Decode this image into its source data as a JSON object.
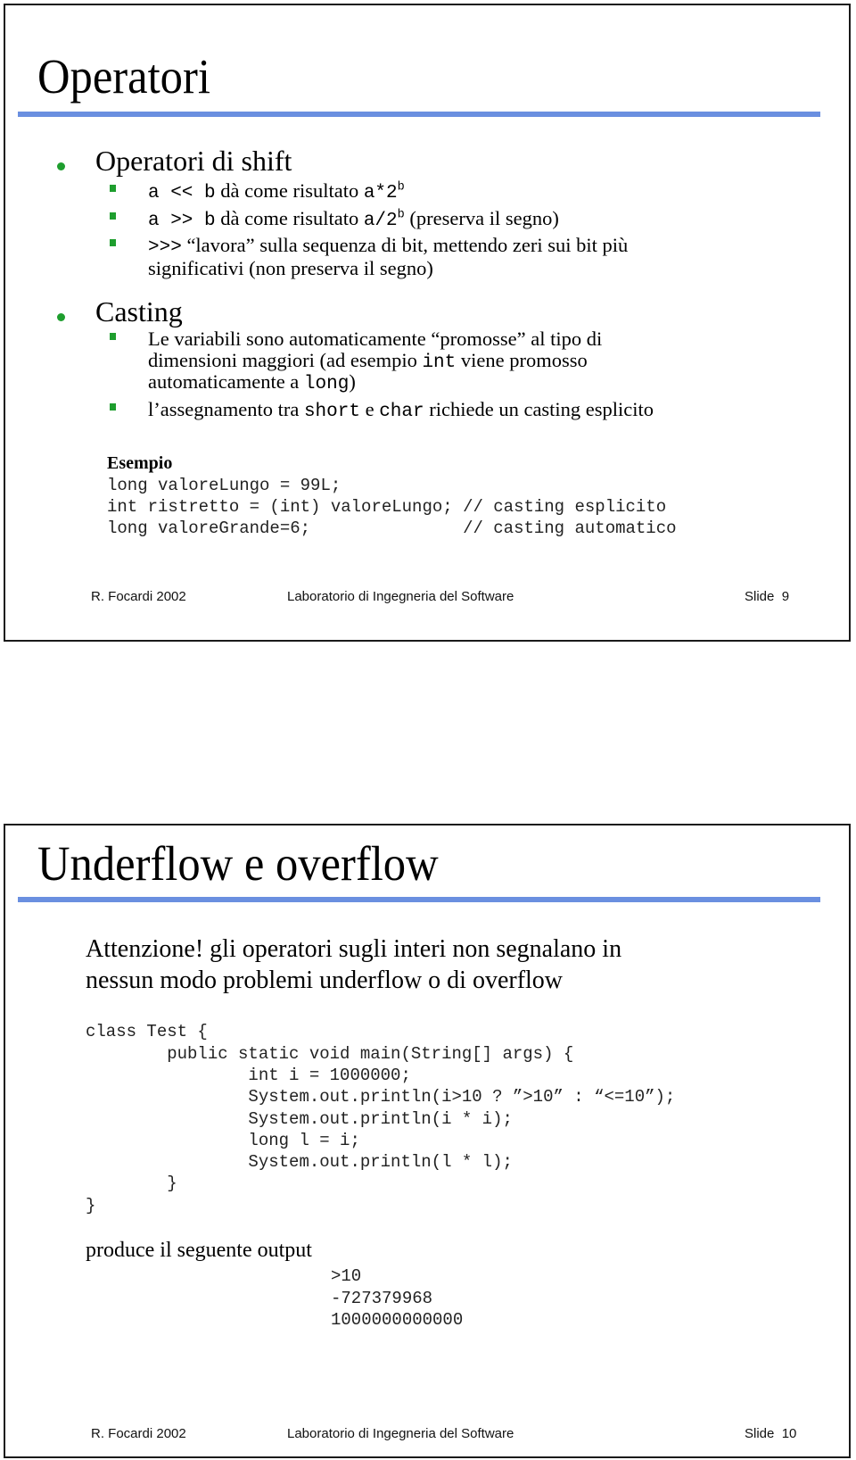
{
  "slides": [
    {
      "title": "Operatori",
      "sections": [
        {
          "heading": "Operatori di shift",
          "items": [
            {
              "code_a": "a << b",
              "text_a": " dà come risultato ",
              "code_b": "a*2",
              "sup": "b",
              "text_b": ""
            },
            {
              "code_a": "a >> b",
              "text_a": " dà come risultato ",
              "code_b": "a/2",
              "sup": "b",
              "text_b": " (preserva il segno)"
            },
            {
              "code_a": ">>>",
              "text_a": " “lavora” sulla sequenza di bit, mettendo zeri sui bit più",
              "line2": "significativi (non preserva il segno)"
            }
          ]
        },
        {
          "heading": "Casting",
          "items": [
            {
              "line1": "Le variabili sono automaticamente “promosse” al tipo di",
              "line2_a": "dimensioni maggiori (ad esempio ",
              "line2_code": "int",
              "line2_b": " viene promosso",
              "line3_a": "automaticamente a ",
              "line3_code": "long",
              "line3_b": ")"
            },
            {
              "text_a": "l’assegnamento tra ",
              "code_a": "short",
              "text_b": " e ",
              "code_b": "char",
              "text_c": " richiede un casting esplicito"
            }
          ]
        }
      ],
      "example": {
        "label": "Esempio",
        "code_lines": [
          "long valoreLungo = 99L;",
          "int ristretto = (int) valoreLungo; // casting esplicito",
          "long valoreGrande=6;               // casting automatico"
        ]
      },
      "footer": {
        "author": "R. Focardi 2002",
        "course": "Laboratorio di Ingegneria del Software",
        "slide": "Slide  9"
      }
    },
    {
      "title": "Underflow e overflow",
      "intro_line1": "Attenzione! gli operatori sugli interi non segnalano in",
      "intro_line2": "nessun modo problemi underflow o di overflow",
      "code_lines": [
        "class Test {",
        "        public static void main(String[] args) {",
        "                int i = 1000000;",
        "                System.out.println(i>10 ? ”>10” : “<=10”);",
        "                System.out.println(i * i);",
        "                long l = i;",
        "                System.out.println(l * l);",
        "        }",
        "}"
      ],
      "output_label": "produce il seguente output",
      "output_lines": [
        ">10",
        "-727379968",
        "1000000000000"
      ],
      "footer": {
        "author": "R. Focardi 2002",
        "course": "Laboratorio di Ingegneria del Software",
        "slide": "Slide  10"
      }
    }
  ],
  "colors": {
    "bullet": "#1e9e2e",
    "title_rule": "#6a8fe0",
    "border": "#1a1a1a"
  }
}
